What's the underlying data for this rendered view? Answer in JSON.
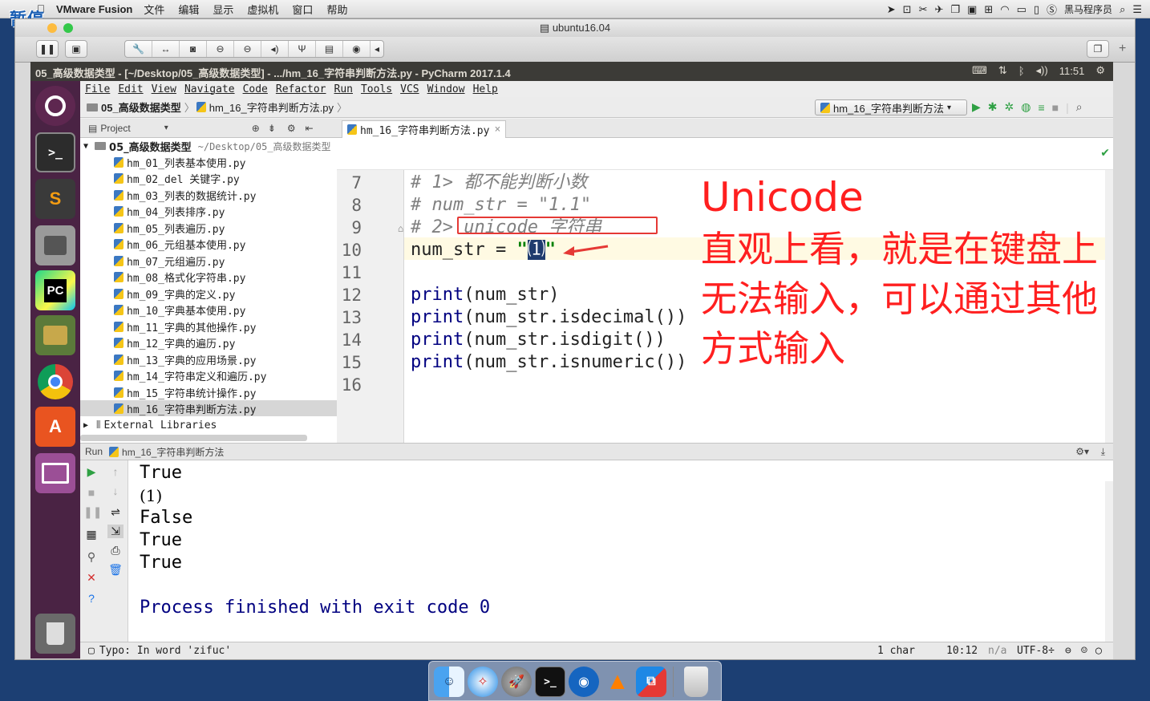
{
  "mac_menubar": {
    "app_name": "VMware Fusion",
    "menus": [
      "文件",
      "编辑",
      "显示",
      "虚拟机",
      "窗口",
      "帮助"
    ],
    "status_user": "黑马程序员"
  },
  "overlay": {
    "pause_label": "暂停"
  },
  "vmware": {
    "window_title": "ubuntu16.04"
  },
  "ubuntu_panel": {
    "window_title": "05_高级数据类型 - [~/Desktop/05_高级数据类型] - .../hm_16_字符串判断方法.py - PyCharm 2017.1.4",
    "clock": "11:51"
  },
  "launcher": {
    "pycharm_label": "PC"
  },
  "pycharm": {
    "menu": [
      "File",
      "Edit",
      "View",
      "Navigate",
      "Code",
      "Refactor",
      "Run",
      "Tools",
      "VCS",
      "Window",
      "Help"
    ],
    "breadcrumb": [
      "05_高级数据类型",
      "hm_16_字符串判断方法.py"
    ],
    "run_config": "hm_16_字符串判断方法",
    "project_panel_title": "Project",
    "tree": {
      "root": "05_高级数据类型",
      "root_path": "~/Desktop/05_高级数据类型",
      "files": [
        "hm_01_列表基本使用.py",
        "hm_02_del 关键字.py",
        "hm_03_列表的数据统计.py",
        "hm_04_列表排序.py",
        "hm_05_列表遍历.py",
        "hm_06_元组基本使用.py",
        "hm_07_元组遍历.py",
        "hm_08_格式化字符串.py",
        "hm_09_字典的定义.py",
        "hm_10_字典基本使用.py",
        "hm_11_字典的其他操作.py",
        "hm_12_字典的遍历.py",
        "hm_13_字典的应用场景.py",
        "hm_14_字符串定义和遍历.py",
        "hm_15_字符串统计操作.py",
        "hm_16_字符串判断方法.py"
      ],
      "external": "External Libraries"
    },
    "editor_tab": "hm_16_字符串判断方法.py",
    "line_numbers": [
      "7",
      "8",
      "9",
      "10",
      "11",
      "12",
      "13",
      "14",
      "15",
      "16"
    ],
    "code": {
      "l7": "# 1> 都不能判断小数",
      "l8": "# num_str = \"1.1\"",
      "l9": "# 2> unicode 字符串",
      "l10_prefix": "num_str = ",
      "l10_q1": "\"",
      "l10_char": "⑴",
      "l10_q2": "\"",
      "l12_fn": "print",
      "l12_rest": "(num_str)",
      "l13_fn": "print",
      "l13_rest": "(num_str.isdecimal())",
      "l14_fn": "print",
      "l14_rest": "(num_str.isdigit())",
      "l15_fn": "print",
      "l15_rest": "(num_str.isnumeric())"
    },
    "annotation": {
      "title": "Unicode",
      "line1": "直观上看，就是在键盘上",
      "line2": "无法输入，可以通过其他",
      "line3": "方式输入"
    },
    "run_panel": {
      "label": "Run",
      "config": "hm_16_字符串判断方法",
      "output": [
        "True",
        "(1)",
        "False",
        "True",
        "True",
        "",
        "Process finished with exit code 0"
      ]
    },
    "status_bar": {
      "typo": "Typo: In word 'zifuc'",
      "selection": "1 char",
      "position": "10:12",
      "line_sep": "n/a",
      "encoding": "UTF-8÷"
    }
  },
  "colors": {
    "annotation_red": "#ff1f1f",
    "launcher_bg": "#4a2344",
    "ubuntu_panel": "#3c3b37"
  }
}
